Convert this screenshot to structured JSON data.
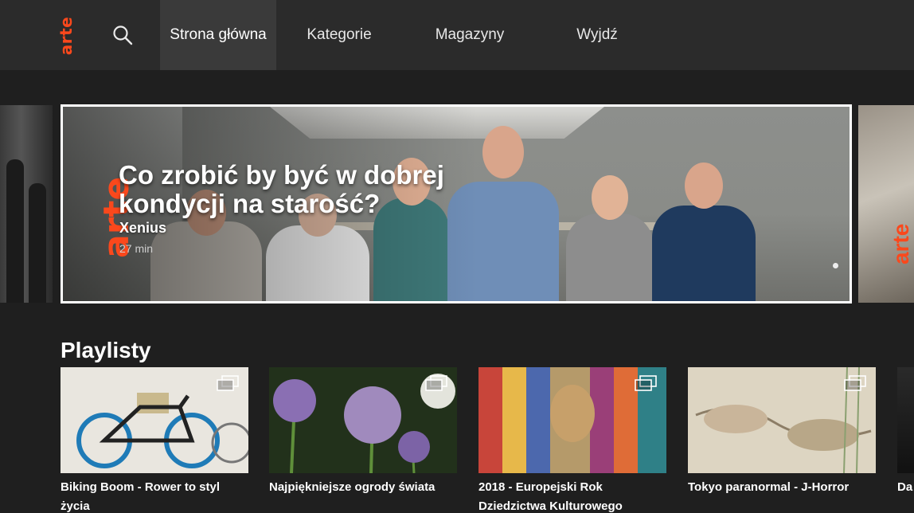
{
  "nav": {
    "logo": "arte",
    "items": [
      {
        "label": "Strona główna",
        "active": true
      },
      {
        "label": "Kategorie",
        "active": false
      },
      {
        "label": "Magazyny",
        "active": false
      },
      {
        "label": "Wyjdź",
        "active": false
      }
    ]
  },
  "hero": {
    "logo": "arte",
    "title": "Co zrobić by być w dobrej kondycji na starość?",
    "subtitle": "Xenius",
    "duration": "27 min"
  },
  "playlists": {
    "title": "Playlisty",
    "items": [
      {
        "label": "Biking Boom - Rower to styl życia"
      },
      {
        "label": "Najpiękniejsze ogrody świata"
      },
      {
        "label": "2018 - Europejski Rok Dziedzictwa Kulturowego"
      },
      {
        "label": "Tokyo paranormal - J-Horror"
      },
      {
        "label": "Da"
      }
    ]
  },
  "side_right_logo": "arte",
  "colors": {
    "accent": "#fa481c",
    "nav_bg": "#2b2b2b",
    "active_nav_bg": "#3a3a3a",
    "page_bg": "#1f1f1f"
  },
  "icons": {
    "search": "search-icon",
    "playlist": "playlist-stack-icon"
  }
}
